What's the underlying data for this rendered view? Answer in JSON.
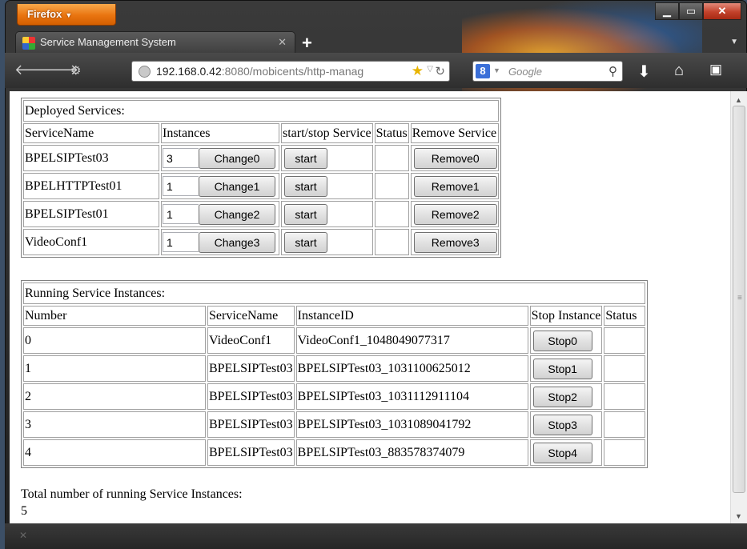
{
  "browser": {
    "app_button": "Firefox",
    "tab_title": "Service Management System",
    "url_host": "192.168.0.42",
    "url_rest": ":8080/mobicents/http-manag",
    "search_placeholder": "Google",
    "search_engine_letter": "8"
  },
  "deployed": {
    "caption": "Deployed Services:",
    "headers": [
      "ServiceName",
      "Instances",
      "start/stop Service",
      "Status",
      "Remove Service"
    ],
    "rows": [
      {
        "name": "BPELSIPTest03",
        "instances": "3",
        "change": "Change0",
        "start": "start",
        "status": "",
        "remove": "Remove0"
      },
      {
        "name": "BPELHTTPTest01",
        "instances": "1",
        "change": "Change1",
        "start": "start",
        "status": "",
        "remove": "Remove1"
      },
      {
        "name": "BPELSIPTest01",
        "instances": "1",
        "change": "Change2",
        "start": "start",
        "status": "",
        "remove": "Remove2"
      },
      {
        "name": "VideoConf1",
        "instances": "1",
        "change": "Change3",
        "start": "start",
        "status": "",
        "remove": "Remove3"
      }
    ]
  },
  "running": {
    "caption": "Running Service Instances:",
    "headers": [
      "Number",
      "ServiceName",
      "InstanceID",
      "Stop Instance",
      "Status"
    ],
    "rows": [
      {
        "number": "0",
        "service": "VideoConf1",
        "instance_id": "VideoConf1_1048049077317",
        "stop": "Stop0",
        "status": ""
      },
      {
        "number": "1",
        "service": "BPELSIPTest03",
        "instance_id": "BPELSIPTest03_1031100625012",
        "stop": "Stop1",
        "status": ""
      },
      {
        "number": "2",
        "service": "BPELSIPTest03",
        "instance_id": "BPELSIPTest03_1031112911104",
        "stop": "Stop2",
        "status": ""
      },
      {
        "number": "3",
        "service": "BPELSIPTest03",
        "instance_id": "BPELSIPTest03_1031089041792",
        "stop": "Stop3",
        "status": ""
      },
      {
        "number": "4",
        "service": "BPELSIPTest03",
        "instance_id": "BPELSIPTest03_883578374079",
        "stop": "Stop4",
        "status": ""
      }
    ]
  },
  "total": {
    "label": "Total number of running Service Instances:",
    "value": "5"
  },
  "icons": {
    "back": "back-arrow-icon",
    "forward": "forward-arrow-icon",
    "site_identity": "site-identity-icon",
    "globe": "globe-icon",
    "bookmark": "bookmark-star-icon",
    "reload": "reload-icon",
    "search": "search-icon",
    "download": "download-arrow-icon",
    "home": "home-icon",
    "menu": "menu-icon"
  },
  "colors": {
    "firefox_orange": "#e97410",
    "chrome_dark": "#2e2e2e"
  }
}
